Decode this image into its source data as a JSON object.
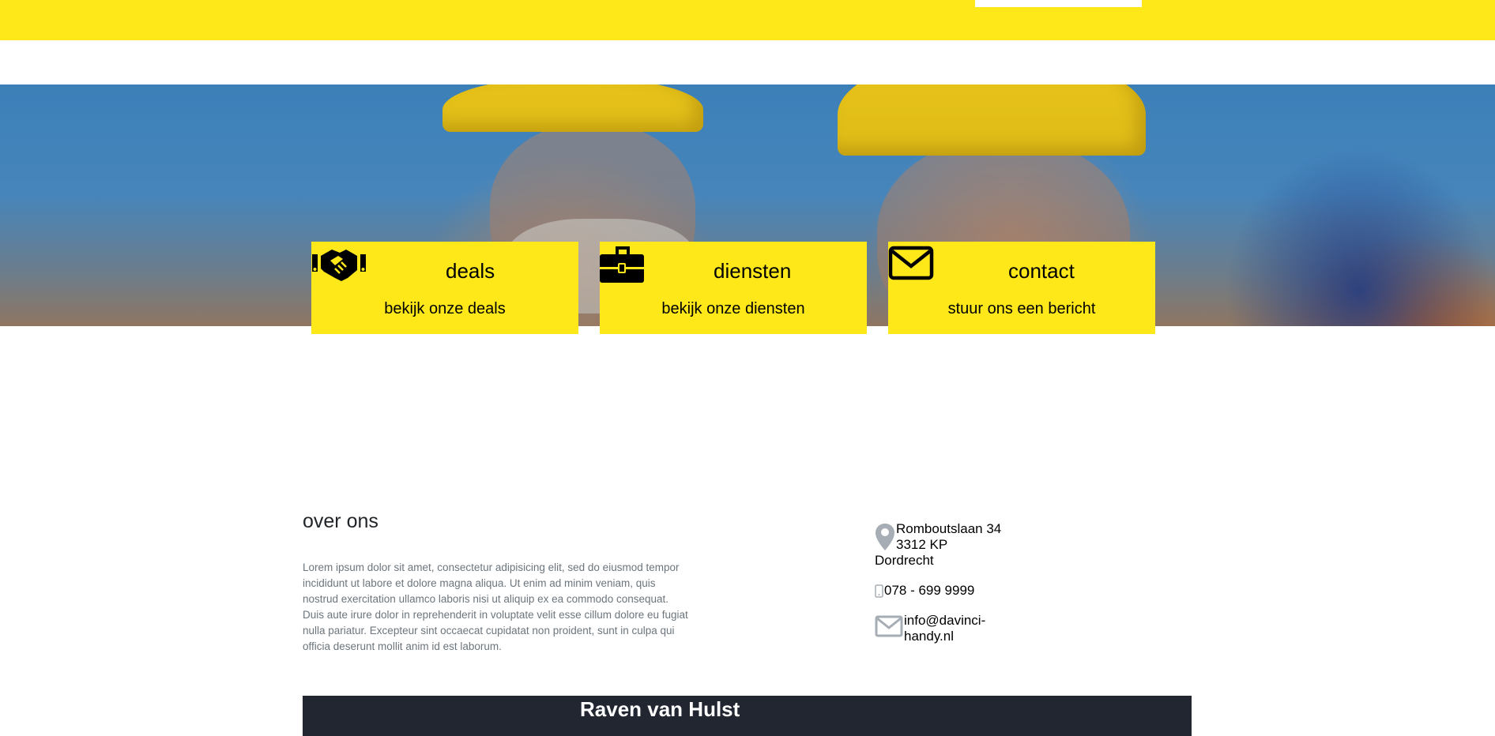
{
  "header": {
    "tab_label": ""
  },
  "hero": {
    "image_alt": "construction workers with yellow helmets"
  },
  "cards": [
    {
      "icon": "handshake-icon",
      "title": "deals",
      "subtitle": "bekijk onze deals"
    },
    {
      "icon": "toolbox-icon",
      "title": "diensten",
      "subtitle": "bekijk onze diensten"
    },
    {
      "icon": "envelope-icon",
      "title": "contact",
      "subtitle": "stuur ons een bericht"
    }
  ],
  "about": {
    "title": "over ons",
    "text": "Lorem ipsum dolor sit amet, consectetur adipisicing elit, sed do eiusmod tempor incididunt ut labore et dolore magna aliqua. Ut enim ad minim veniam, quis nostrud exercitation ullamco laboris nisi ut aliquip ex ea commodo consequat. Duis aute irure dolor in reprehenderit in voluptate velit esse cillum dolore eu fugiat nulla pariatur. Excepteur sint occaecat cupidatat non proident, sunt in culpa qui officia deserunt mollit anim id est laborum."
  },
  "contact": {
    "address_line1": "Romboutslaan 34",
    "address_line2": "3312 KP",
    "address_line3": "Dordrecht",
    "phone": "078 - 699 9999",
    "email_line1": "info@davinci-",
    "email_line2": "handy.nl"
  },
  "footer": {
    "name": "Raven van Hulst"
  },
  "colors": {
    "brand_yellow": "#ffe81a",
    "footer_dark": "#212630",
    "icon_gray": "#a7adb4"
  }
}
